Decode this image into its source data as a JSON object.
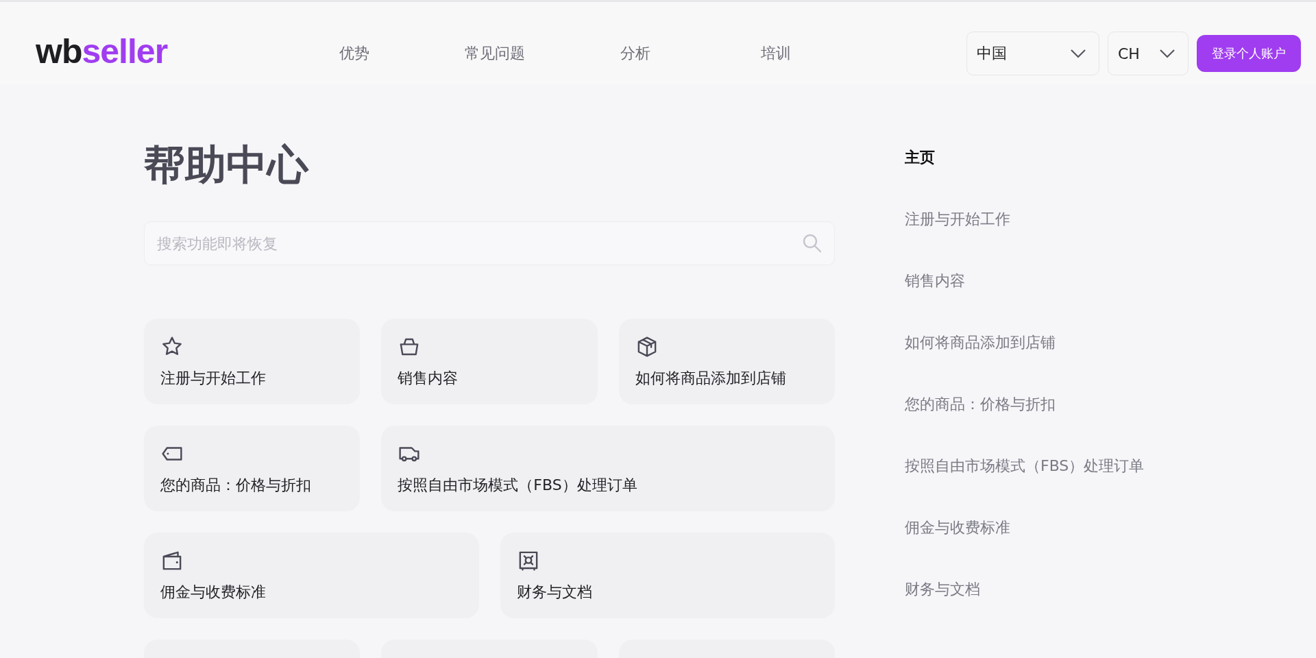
{
  "header": {
    "logo": {
      "dark": "wb",
      "accent": "seller"
    },
    "nav": [
      "优势",
      "常见问题",
      "分析",
      "培训"
    ],
    "country_select": {
      "value": "中国"
    },
    "language_select": {
      "value": "CH"
    },
    "login_button": "登录个人账户"
  },
  "main": {
    "title": "帮助中心",
    "search": {
      "placeholder": "搜索功能即将恢复"
    },
    "card_rows": [
      [
        {
          "title": "注册与开始工作"
        },
        {
          "title": "销售内容"
        },
        {
          "title": "如何将商品添加到店铺"
        }
      ],
      [
        {
          "title": "您的商品：价格与折扣"
        },
        {
          "title": "按照自由市场模式（FBS）处理订单"
        }
      ],
      [
        {
          "title": "佣金与收费标准"
        },
        {
          "title": "财务与文档"
        }
      ],
      [
        {},
        {},
        {}
      ]
    ]
  },
  "sidebar": {
    "items": [
      {
        "label": "主页",
        "selected": true
      },
      {
        "label": "注册与开始工作",
        "selected": false
      },
      {
        "label": "销售内容",
        "selected": false
      },
      {
        "label": "如何将商品添加到店铺",
        "selected": false
      },
      {
        "label": "您的商品：价格与折扣",
        "selected": false
      },
      {
        "label": "按照自由市场模式（FBS）处理订单",
        "selected": false
      },
      {
        "label": "佣金与收费标准",
        "selected": false
      },
      {
        "label": "财务与文档",
        "selected": false
      }
    ]
  }
}
